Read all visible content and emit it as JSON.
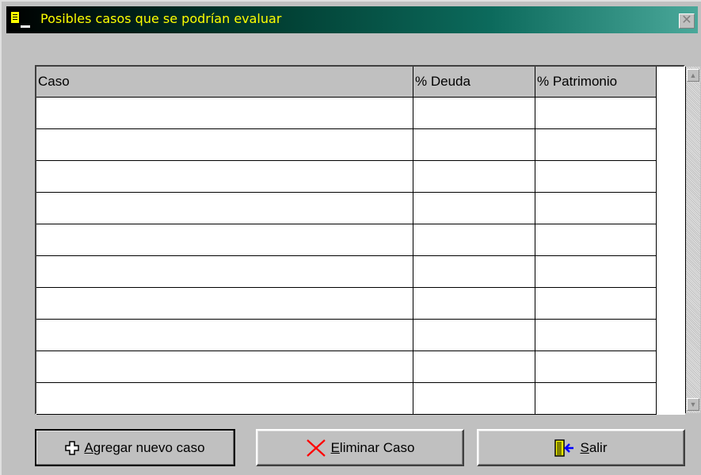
{
  "window": {
    "title": "Posibles casos que se podrían evaluar",
    "close_glyph": "✕"
  },
  "grid": {
    "columns": [
      "Caso",
      "% Deuda",
      "% Patrimonio"
    ],
    "rows": [
      [
        "",
        "",
        ""
      ],
      [
        "",
        "",
        ""
      ],
      [
        "",
        "",
        ""
      ],
      [
        "",
        "",
        ""
      ],
      [
        "",
        "",
        ""
      ],
      [
        "",
        "",
        ""
      ],
      [
        "",
        "",
        ""
      ],
      [
        "",
        "",
        ""
      ],
      [
        "",
        "",
        ""
      ],
      [
        "",
        "",
        ""
      ]
    ]
  },
  "buttons": {
    "add": {
      "underline": "A",
      "rest": "gregar nuevo caso",
      "icon": "plus-icon"
    },
    "delete": {
      "underline": "E",
      "rest": "liminar Caso",
      "icon": "red-x-icon"
    },
    "exit": {
      "underline": "S",
      "rest": "alir",
      "icon": "exit-door-icon"
    }
  },
  "colors": {
    "title_text": "#ffff00",
    "delete_icon": "#ff0000"
  }
}
